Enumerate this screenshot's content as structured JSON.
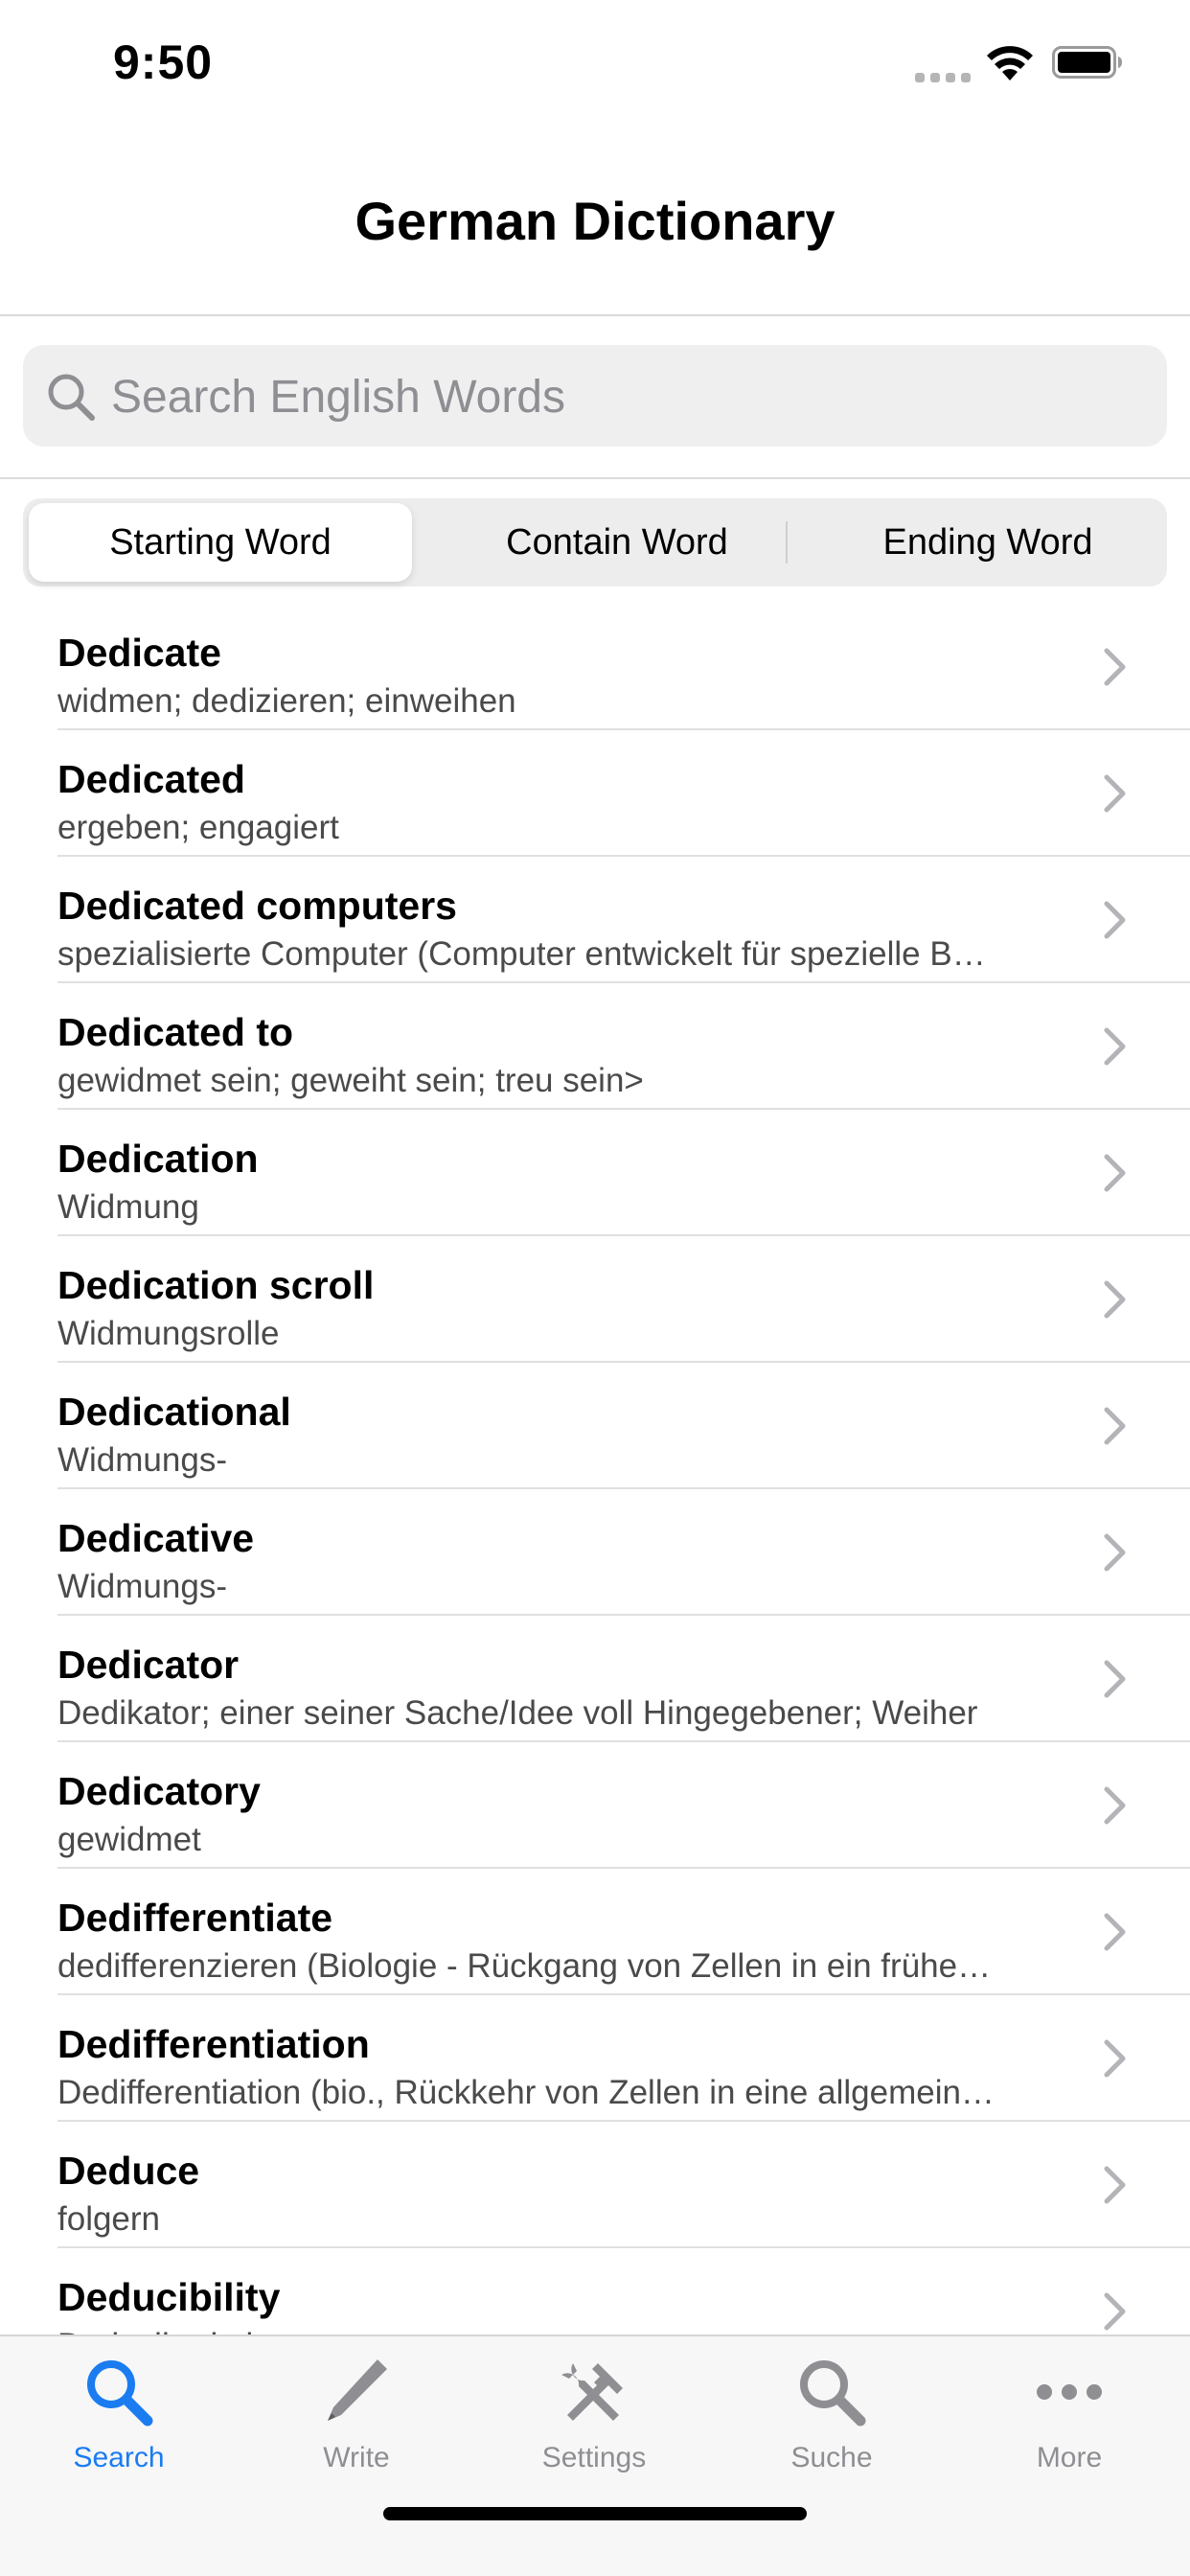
{
  "status_bar": {
    "time": "9:50"
  },
  "nav": {
    "title": "German Dictionary"
  },
  "search": {
    "placeholder": "Search English Words"
  },
  "segments": [
    {
      "label": "Starting Word",
      "selected": true
    },
    {
      "label": "Contain Word",
      "selected": false
    },
    {
      "label": "Ending Word",
      "selected": false
    }
  ],
  "entries": [
    {
      "word": "Dedicate",
      "translation": "widmen; dedizieren; einweihen"
    },
    {
      "word": "Dedicated",
      "translation": "ergeben; engagiert"
    },
    {
      "word": "Dedicated computers",
      "translation": "spezialisierte Computer (Computer entwickelt für spezielle B…"
    },
    {
      "word": "Dedicated to",
      "translation": "gewidmet sein; geweiht sein; treu sein>"
    },
    {
      "word": "Dedication",
      "translation": "Widmung"
    },
    {
      "word": "Dedication scroll",
      "translation": "Widmungsrolle"
    },
    {
      "word": "Dedicational",
      "translation": "Widmungs-"
    },
    {
      "word": "Dedicative",
      "translation": "Widmungs-"
    },
    {
      "word": "Dedicator",
      "translation": "Dedikator; einer seiner Sache/Idee voll Hingegebener; Weiher"
    },
    {
      "word": "Dedicatory",
      "translation": "gewidmet"
    },
    {
      "word": "Dedifferentiate",
      "translation": "dedifferenzieren (Biologie - Rückgang von Zellen in ein frühe…"
    },
    {
      "word": "Dedifferentiation",
      "translation": "Dedifferentiation (bio., Rückkehr von Zellen in eine allgemein…"
    },
    {
      "word": "Deduce",
      "translation": "folgern"
    },
    {
      "word": "Deducibility",
      "translation": "Deducibarkeit"
    }
  ],
  "tabs": [
    {
      "label": "Search",
      "icon": "magnifier-icon",
      "active": true
    },
    {
      "label": "Write",
      "icon": "pencil-icon",
      "active": false
    },
    {
      "label": "Settings",
      "icon": "tools-icon",
      "active": false
    },
    {
      "label": "Suche",
      "icon": "magnifier-icon",
      "active": false
    },
    {
      "label": "More",
      "icon": "ellipsis-icon",
      "active": false
    }
  ],
  "colors": {
    "accent": "#1a7cf0",
    "inactive": "#8e8e93"
  }
}
